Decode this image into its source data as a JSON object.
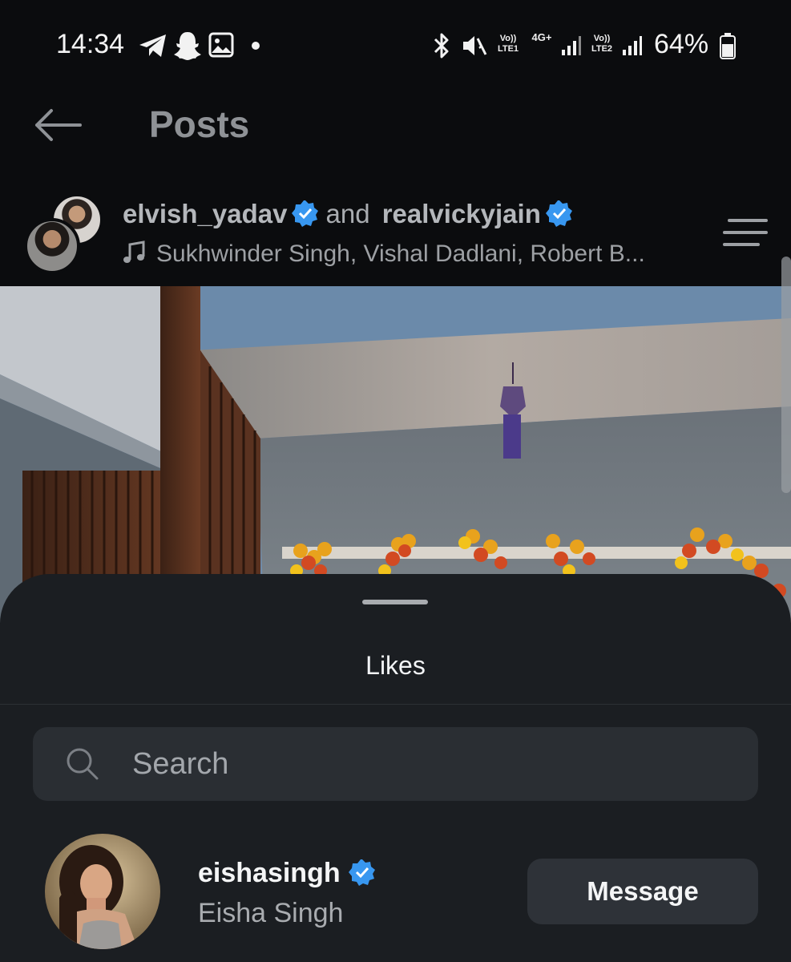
{
  "status_bar": {
    "time": "14:34",
    "left_icons": [
      "telegram-icon",
      "snapchat-icon",
      "gallery-icon",
      "notification-dot-icon"
    ],
    "right_icons": [
      "bluetooth-icon",
      "mute-icon",
      "signal-icon",
      "signal-icon",
      "battery-icon"
    ],
    "sim1_label": "Vo)) LTE1",
    "network_type": "4G+",
    "sim2_label": "Vo)) LTE2",
    "battery": "64%"
  },
  "header": {
    "title": "Posts",
    "back_icon": "arrow-left-icon"
  },
  "post": {
    "user1": "elvish_yadav",
    "joiner": "and",
    "user2": "realvickyjain",
    "audio": "Sukhwinder Singh, Vishal Dadlani, Robert B...",
    "verified_color": "#3897f0"
  },
  "likes_sheet": {
    "title": "Likes",
    "search_placeholder": "Search",
    "users": [
      {
        "username": "eishasingh",
        "full_name": "Eisha Singh",
        "verified": true,
        "action_label": "Message"
      }
    ]
  },
  "colors": {
    "background": "#0b0c0e",
    "sheet": "#1b1e22",
    "search_bg": "#2a2e33",
    "button_bg": "#2e3238",
    "verified_blue": "#3897f0"
  }
}
